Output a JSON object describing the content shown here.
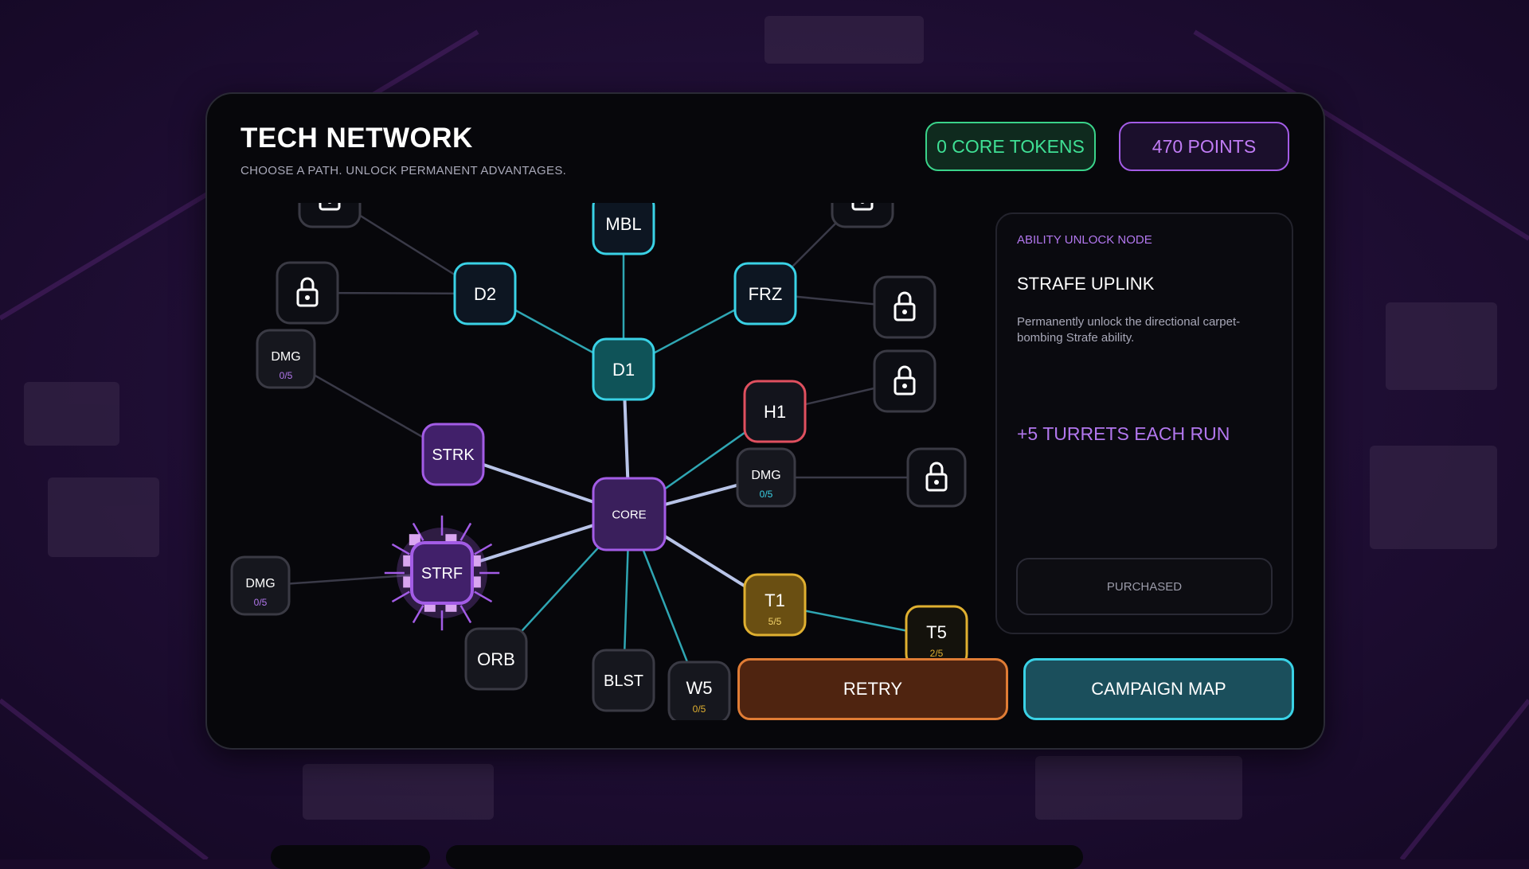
{
  "header": {
    "title": "TECH NETWORK",
    "subtitle": "CHOOSE A PATH. UNLOCK PERMANENT ADVANTAGES."
  },
  "currency": {
    "tokens_label": "0 CORE TOKENS",
    "points_label": "470 POINTS"
  },
  "info_panel": {
    "tag": "ABILITY UNLOCK NODE",
    "name": "STRAFE UPLINK",
    "description": "Permanently unlock the directional carpet-bombing Strafe ability.",
    "bonus": "+5 TURRETS EACH RUN",
    "status_label": "PURCHASED"
  },
  "actions": {
    "retry_label": "RETRY",
    "campaign_label": "CAMPAIGN MAP"
  },
  "colors": {
    "teal": "#3ad2e6",
    "purple": "#a35ce6",
    "red": "#e0505f",
    "gold": "#e0b030",
    "grey": "#3a3a44",
    "green": "#3ad38a",
    "orange": "#e07c35"
  },
  "tree": {
    "nodes": [
      {
        "id": "core",
        "label": "CORE",
        "theme": "core",
        "selected": false
      },
      {
        "id": "d1",
        "label": "D1",
        "theme": "teal-filled"
      },
      {
        "id": "d2",
        "label": "D2",
        "theme": "teal"
      },
      {
        "id": "frz",
        "label": "FRZ",
        "theme": "teal"
      },
      {
        "id": "mbl",
        "label": "MBL",
        "theme": "teal"
      },
      {
        "id": "strk",
        "label": "STRK",
        "theme": "purple"
      },
      {
        "id": "strf",
        "label": "STRF",
        "theme": "purple",
        "selected": true
      },
      {
        "id": "h1",
        "label": "H1",
        "theme": "red"
      },
      {
        "id": "t1",
        "label": "T1",
        "sub": "5/5",
        "theme": "gold-filled"
      },
      {
        "id": "t5",
        "label": "T5",
        "sub": "2/5",
        "theme": "gold"
      },
      {
        "id": "orb",
        "label": "ORB",
        "theme": "grey"
      },
      {
        "id": "blst",
        "label": "BLST",
        "theme": "grey"
      },
      {
        "id": "w5",
        "label": "W5",
        "sub": "0/5",
        "theme": "grey-gold"
      },
      {
        "id": "dmg1",
        "label": "DMG",
        "sub": "0/5",
        "theme": "grey-purple"
      },
      {
        "id": "dmg2",
        "label": "DMG",
        "sub": "0/5",
        "theme": "grey-purple"
      },
      {
        "id": "dmg3",
        "label": "DMG",
        "sub": "0/5",
        "theme": "grey-teal"
      },
      {
        "id": "lock1",
        "label": "",
        "theme": "locked"
      },
      {
        "id": "lock2",
        "label": "",
        "theme": "locked"
      },
      {
        "id": "lock3",
        "label": "",
        "theme": "locked"
      },
      {
        "id": "lock4",
        "label": "",
        "theme": "locked"
      },
      {
        "id": "lock5",
        "label": "",
        "theme": "locked"
      },
      {
        "id": "lock6",
        "label": "",
        "theme": "locked"
      }
    ],
    "edges": [
      [
        "core",
        "d1",
        "light"
      ],
      [
        "d1",
        "d2",
        "teal"
      ],
      [
        "d1",
        "frz",
        "teal"
      ],
      [
        "d1",
        "mbl",
        "teal"
      ],
      [
        "core",
        "strk",
        "light"
      ],
      [
        "core",
        "strf",
        "light"
      ],
      [
        "core",
        "h1",
        "teal"
      ],
      [
        "core",
        "dmg3",
        "light"
      ],
      [
        "core",
        "t1",
        "light"
      ],
      [
        "core",
        "orb",
        "teal"
      ],
      [
        "core",
        "blst",
        "teal"
      ],
      [
        "core",
        "w5",
        "teal"
      ],
      [
        "t1",
        "t5",
        "teal"
      ],
      [
        "strk",
        "dmg1",
        "grey"
      ],
      [
        "strf",
        "dmg2",
        "grey"
      ],
      [
        "d2",
        "lock1",
        "grey"
      ],
      [
        "frz",
        "lock2",
        "grey"
      ],
      [
        "h1",
        "lock3",
        "grey"
      ],
      [
        "dmg3",
        "lock4",
        "grey"
      ],
      [
        "d2",
        "lock5",
        "grey"
      ],
      [
        "frz",
        "lock6",
        "grey"
      ]
    ]
  }
}
